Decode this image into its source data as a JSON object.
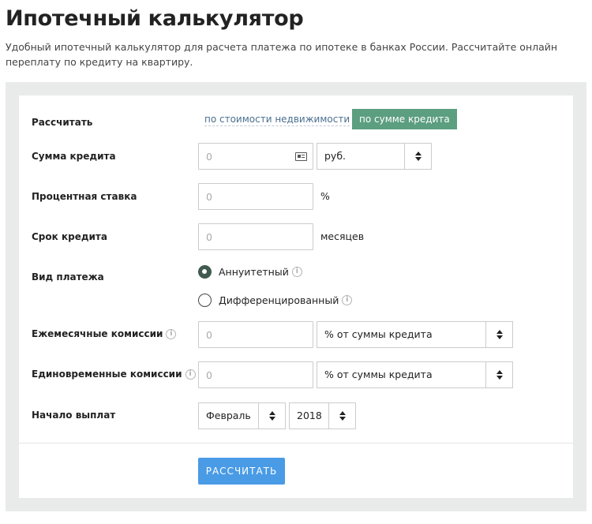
{
  "page": {
    "title": "Ипотечный калькулятор",
    "description": "Удобный ипотечный калькулятор для расчета платежа по ипотеке в банках России. Рассчитайте онлайн переплату по кредиту на квартиру."
  },
  "form": {
    "calc_mode": {
      "label": "Рассчитать",
      "options": [
        "по стоимости недвижимости",
        "по сумме кредита"
      ],
      "selected": "по сумме кредита"
    },
    "loan_amount": {
      "label": "Сумма кредита",
      "placeholder": "0",
      "value": "",
      "currency": "руб."
    },
    "interest_rate": {
      "label": "Процентная ставка",
      "placeholder": "0",
      "value": "",
      "unit": "%"
    },
    "loan_term": {
      "label": "Срок кредита",
      "placeholder": "0",
      "value": "",
      "unit": "месяцев"
    },
    "payment_type": {
      "label": "Вид платежа",
      "options": [
        "Аннуитетный",
        "Дифференцированный"
      ],
      "selected": "Аннуитетный"
    },
    "monthly_fees": {
      "label": "Ежемесячные комиссии",
      "placeholder": "0",
      "value": "",
      "basis": "% от суммы кредита"
    },
    "one_time_fees": {
      "label": "Единовременные комиссии",
      "placeholder": "0",
      "value": "",
      "basis": "% от суммы кредита"
    },
    "start": {
      "label": "Начало выплат",
      "month": "Февраль",
      "year": "2018"
    },
    "submit_label": "РАССЧИТАТЬ"
  },
  "info_glyph": "i",
  "colors": {
    "active_tab": "#5c9e80",
    "button": "#4a9be6",
    "link": "#4a6f8f",
    "radio_on": "#415a4d"
  }
}
